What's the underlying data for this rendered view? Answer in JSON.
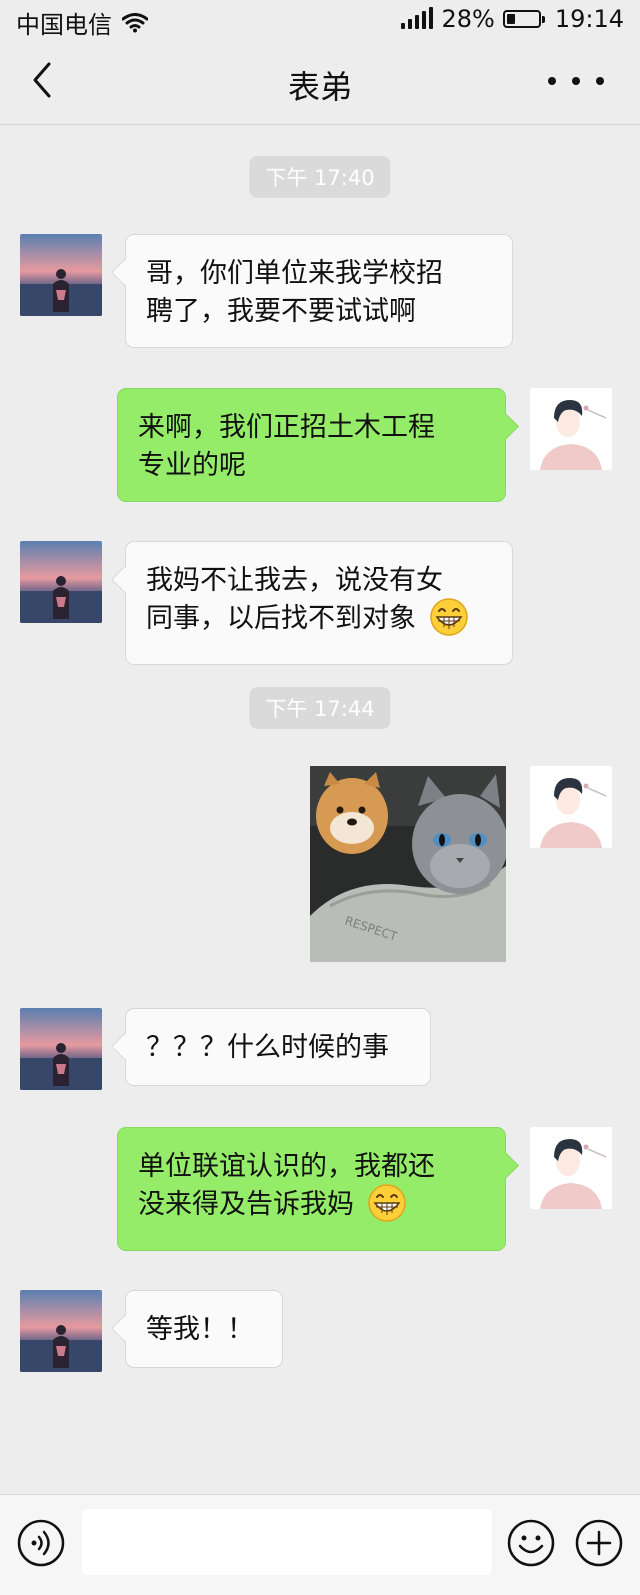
{
  "status_bar": {
    "carrier": "中国电信",
    "battery_text": "28%",
    "battery_level": 0.28,
    "time": "19:14"
  },
  "nav": {
    "title": "表弟",
    "back_icon": "chevron-left-icon",
    "more_icon": "more-dots-icon"
  },
  "chat": {
    "timestamps": [
      "下午 17:40",
      "下午 17:44"
    ],
    "messages": [
      {
        "side": "left",
        "lines": [
          "哥，你们单位来我学校招",
          "聘了，我要不要试试啊"
        ]
      },
      {
        "side": "right",
        "lines": [
          "来啊，我们正招土木工程",
          "专业的呢"
        ]
      },
      {
        "side": "left",
        "lines": [
          "我妈不让我去，说没有女",
          "同事，以后找不到对象"
        ],
        "emoji": "grin-emoji"
      },
      {
        "side": "right",
        "type": "image",
        "alt": "doge-and-cat-photo"
      },
      {
        "side": "left",
        "lines": [
          "？？？什么时候的事"
        ]
      },
      {
        "side": "right",
        "lines": [
          "单位联谊认识的，我都还",
          "没来得及告诉我妈"
        ],
        "emoji": "grin-emoji"
      },
      {
        "side": "left",
        "lines": [
          "等我！！"
        ]
      }
    ]
  },
  "bottom_bar": {
    "voice_icon": "voice-icon",
    "emoji_icon": "smiley-icon",
    "plus_icon": "plus-circle-icon",
    "input_value": ""
  },
  "colors": {
    "background": "#ededed",
    "bubble_self": "#95ec69",
    "bubble_other": "#fafafa"
  }
}
